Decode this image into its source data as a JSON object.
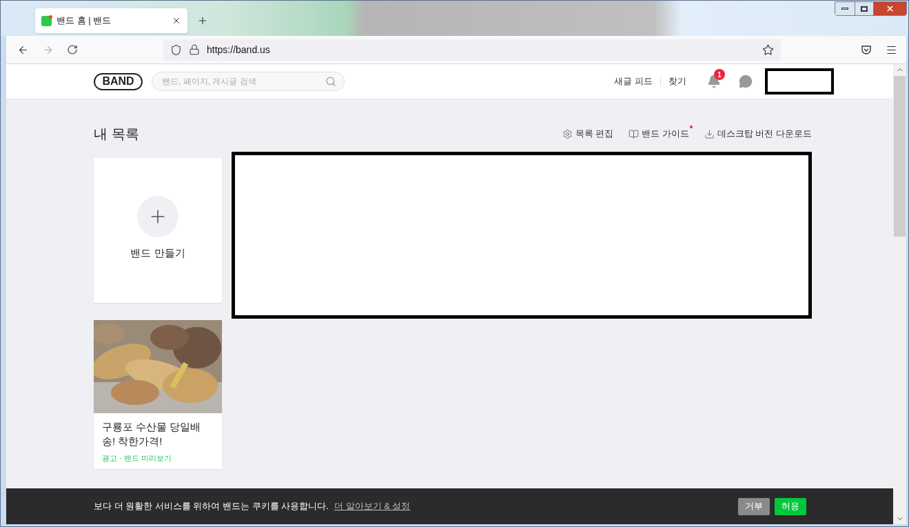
{
  "browser": {
    "tab": {
      "title": "밴드 홈 | 밴드",
      "selected": true
    },
    "url": "https://band.us"
  },
  "header": {
    "logo": "BAND",
    "search": {
      "placeholder": "밴드, 페이지, 게시글 검색"
    },
    "nav": [
      "새글 피드",
      "찾기"
    ],
    "notification_count": "1"
  },
  "section": {
    "title": "내 목록",
    "actions": [
      {
        "kind": "settings",
        "label": "목록 편집",
        "new": false
      },
      {
        "kind": "guide",
        "label": "밴드 가이드",
        "new": true
      },
      {
        "kind": "download",
        "label": "데스크탑 버전 다운로드",
        "new": false
      }
    ]
  },
  "create_card": {
    "label": "밴드 만들기"
  },
  "ad": {
    "kind": "picture",
    "title": "구룡포 수산물 당일배송! 착한가격!",
    "meta": "광고 · 밴드 미리보기"
  },
  "cookie_bar": {
    "message": "보다 더 원활한 서비스를 위하여 밴드는 쿠키를 사용합니다.",
    "link": "더 알아보기 & 설정",
    "buttons": [
      {
        "kind": "reject",
        "label": "거부"
      },
      {
        "kind": "accept",
        "label": "허용"
      }
    ]
  }
}
